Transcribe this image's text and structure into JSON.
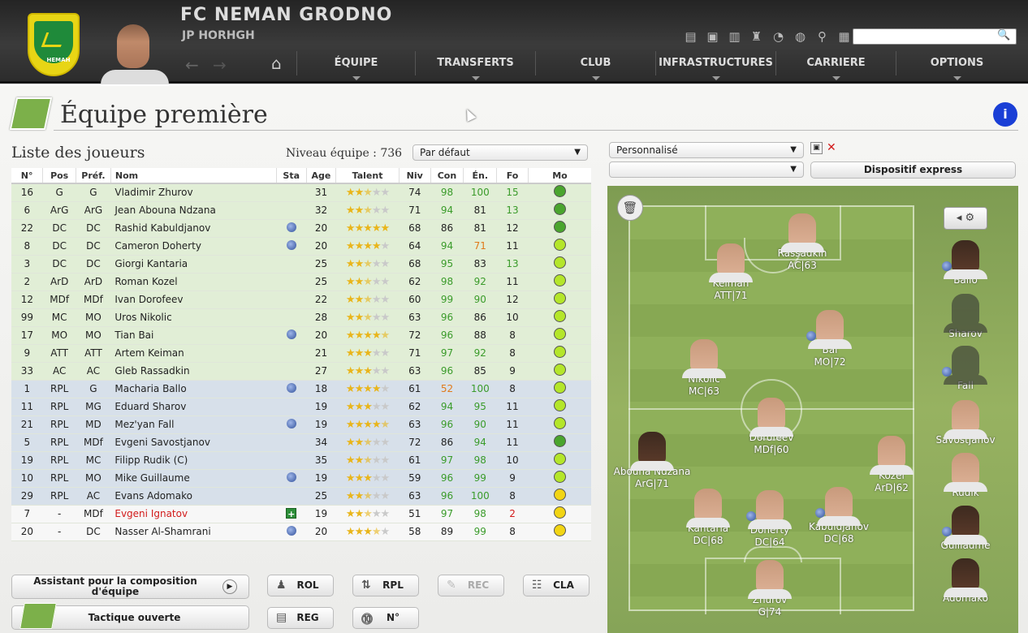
{
  "header": {
    "club_name": "FC NEMAN GRODNO",
    "manager_name": "JP HORHGH",
    "crest_text": "НЕМАН",
    "menu": [
      {
        "label": "ÉQUIPE"
      },
      {
        "label": "TRANSFERTS"
      },
      {
        "label": "CLUB"
      },
      {
        "label": "INFRASTRUCTURES"
      },
      {
        "label": "CARRIERE"
      },
      {
        "label": "OPTIONS"
      }
    ],
    "search": {
      "value": "",
      "placeholder": ""
    }
  },
  "page": {
    "title": "Équipe première",
    "info_label": "i"
  },
  "list": {
    "title": "Liste des joueurs",
    "team_level": "Niveau équipe : 736",
    "sort_select": "Par défaut",
    "columns": [
      "N°",
      "Pos",
      "Préf.",
      "Nom",
      "Sta",
      "Age",
      "Talent",
      "Niv",
      "Con",
      "Én.",
      "Fo",
      "Mo"
    ],
    "rows": [
      {
        "group": "first",
        "num": "16",
        "pos": "G",
        "pref": "G",
        "name": "Vladimir Zhurov",
        "sta": "",
        "age": "31",
        "stars": 2.5,
        "niv": "74",
        "con": "98",
        "en": "100",
        "fo": "15",
        "mo": "green",
        "con_c": "#3a9b2a",
        "en_c": "#3a9b2a",
        "fo_c": "#3a9b2a",
        "name_c": ""
      },
      {
        "group": "first",
        "num": "6",
        "pos": "ArG",
        "pref": "ArG",
        "name": "Jean Abouna Ndzana",
        "sta": "",
        "age": "32",
        "stars": 2.5,
        "niv": "71",
        "con": "94",
        "en": "81",
        "fo": "13",
        "mo": "green",
        "con_c": "#3a9b2a",
        "en_c": "",
        "fo_c": "#3a9b2a",
        "name_c": ""
      },
      {
        "group": "first",
        "num": "22",
        "pos": "DC",
        "pref": "DC",
        "name": "Rashid Kabuldjanov",
        "sta": "globe",
        "age": "20",
        "stars": 5,
        "niv": "68",
        "con": "86",
        "en": "81",
        "fo": "12",
        "mo": "green",
        "con_c": "",
        "en_c": "",
        "fo_c": "",
        "name_c": ""
      },
      {
        "group": "first",
        "num": "8",
        "pos": "DC",
        "pref": "DC",
        "name": "Cameron Doherty",
        "sta": "globe",
        "age": "20",
        "stars": 4,
        "niv": "64",
        "con": "94",
        "en": "71",
        "fo": "11",
        "mo": "lime",
        "con_c": "#3a9b2a",
        "en_c": "#e07a1a",
        "fo_c": "",
        "name_c": ""
      },
      {
        "group": "first",
        "num": "3",
        "pos": "DC",
        "pref": "DC",
        "name": "Giorgi Kantaria",
        "sta": "",
        "age": "25",
        "stars": 2.5,
        "niv": "68",
        "con": "95",
        "en": "83",
        "fo": "13",
        "mo": "lime",
        "con_c": "#3a9b2a",
        "en_c": "",
        "fo_c": "#3a9b2a",
        "name_c": ""
      },
      {
        "group": "first",
        "num": "2",
        "pos": "ArD",
        "pref": "ArD",
        "name": "Roman Kozel",
        "sta": "",
        "age": "25",
        "stars": 2.5,
        "niv": "62",
        "con": "98",
        "en": "92",
        "fo": "11",
        "mo": "lime",
        "con_c": "#3a9b2a",
        "en_c": "#3a9b2a",
        "fo_c": "",
        "name_c": ""
      },
      {
        "group": "first",
        "num": "12",
        "pos": "MDf",
        "pref": "MDf",
        "name": "Ivan Dorofeev",
        "sta": "",
        "age": "22",
        "stars": 2.5,
        "niv": "60",
        "con": "99",
        "en": "90",
        "fo": "12",
        "mo": "lime",
        "con_c": "#3a9b2a",
        "en_c": "#3a9b2a",
        "fo_c": "",
        "name_c": ""
      },
      {
        "group": "first",
        "num": "99",
        "pos": "MC",
        "pref": "MO",
        "name": "Uros Nikolic",
        "sta": "",
        "age": "28",
        "stars": 2.5,
        "niv": "63",
        "con": "96",
        "en": "86",
        "fo": "10",
        "mo": "lime",
        "con_c": "#3a9b2a",
        "en_c": "",
        "fo_c": "",
        "name_c": ""
      },
      {
        "group": "first",
        "num": "17",
        "pos": "MO",
        "pref": "MO",
        "name": "Tian Bai",
        "sta": "globe",
        "age": "20",
        "stars": 4.5,
        "niv": "72",
        "con": "96",
        "en": "88",
        "fo": "8",
        "mo": "lime",
        "con_c": "#3a9b2a",
        "en_c": "",
        "fo_c": "",
        "name_c": ""
      },
      {
        "group": "first",
        "num": "9",
        "pos": "ATT",
        "pref": "ATT",
        "name": "Artem Keiman",
        "sta": "",
        "age": "21",
        "stars": 3,
        "niv": "71",
        "con": "97",
        "en": "92",
        "fo": "8",
        "mo": "lime",
        "con_c": "#3a9b2a",
        "en_c": "#3a9b2a",
        "fo_c": "",
        "name_c": ""
      },
      {
        "group": "first",
        "num": "33",
        "pos": "AC",
        "pref": "AC",
        "name": "Gleb Rassadkin",
        "sta": "",
        "age": "27",
        "stars": 3,
        "niv": "63",
        "con": "96",
        "en": "85",
        "fo": "9",
        "mo": "lime",
        "con_c": "#3a9b2a",
        "en_c": "",
        "fo_c": "",
        "name_c": ""
      },
      {
        "group": "rpl",
        "num": "1",
        "pos": "RPL",
        "pref": "G",
        "name": "Macharia Ballo",
        "sta": "globe",
        "age": "18",
        "stars": 4,
        "niv": "61",
        "con": "52",
        "en": "100",
        "fo": "8",
        "mo": "lime",
        "con_c": "#e07a1a",
        "en_c": "#3a9b2a",
        "fo_c": "",
        "name_c": ""
      },
      {
        "group": "rpl",
        "num": "11",
        "pos": "RPL",
        "pref": "MG",
        "name": "Eduard Sharov",
        "sta": "",
        "age": "19",
        "stars": 3,
        "niv": "62",
        "con": "94",
        "en": "95",
        "fo": "11",
        "mo": "lime",
        "con_c": "#3a9b2a",
        "en_c": "#3a9b2a",
        "fo_c": "",
        "name_c": ""
      },
      {
        "group": "rpl",
        "num": "21",
        "pos": "RPL",
        "pref": "MD",
        "name": "Mez'yan Fall",
        "sta": "globe",
        "age": "19",
        "stars": 4.5,
        "niv": "63",
        "con": "96",
        "en": "90",
        "fo": "11",
        "mo": "lime",
        "con_c": "#3a9b2a",
        "en_c": "#3a9b2a",
        "fo_c": "",
        "name_c": ""
      },
      {
        "group": "rpl",
        "num": "5",
        "pos": "RPL",
        "pref": "MDf",
        "name": "Evgeni Savostjanov",
        "sta": "",
        "age": "34",
        "stars": 2.5,
        "niv": "72",
        "con": "86",
        "en": "94",
        "fo": "11",
        "mo": "green",
        "con_c": "",
        "en_c": "#3a9b2a",
        "fo_c": "",
        "name_c": ""
      },
      {
        "group": "rpl",
        "num": "19",
        "pos": "RPL",
        "pref": "MC",
        "name": "Filipp Rudik (C)",
        "sta": "",
        "age": "35",
        "stars": 2.5,
        "niv": "61",
        "con": "97",
        "en": "98",
        "fo": "10",
        "mo": "lime",
        "con_c": "#3a9b2a",
        "en_c": "#3a9b2a",
        "fo_c": "",
        "name_c": ""
      },
      {
        "group": "rpl",
        "num": "10",
        "pos": "RPL",
        "pref": "MO",
        "name": "Mike Guillaume",
        "sta": "globe",
        "age": "19",
        "stars": 3,
        "niv": "59",
        "con": "96",
        "en": "99",
        "fo": "9",
        "mo": "lime",
        "con_c": "#3a9b2a",
        "en_c": "#3a9b2a",
        "fo_c": "",
        "name_c": ""
      },
      {
        "group": "rpl",
        "num": "29",
        "pos": "RPL",
        "pref": "AC",
        "name": "Evans Adomako",
        "sta": "",
        "age": "25",
        "stars": 2.5,
        "niv": "63",
        "con": "96",
        "en": "100",
        "fo": "8",
        "mo": "yellow",
        "con_c": "#3a9b2a",
        "en_c": "#3a9b2a",
        "fo_c": "",
        "name_c": ""
      },
      {
        "group": "other",
        "num": "7",
        "pos": "-",
        "pref": "MDf",
        "name": "Evgeni Ignatov",
        "sta": "inj",
        "age": "19",
        "stars": 2.5,
        "niv": "51",
        "con": "97",
        "en": "98",
        "fo": "2",
        "mo": "yellow",
        "con_c": "#3a9b2a",
        "en_c": "#3a9b2a",
        "fo_c": "#d21a1a",
        "name_c": "#d21a1a"
      },
      {
        "group": "other",
        "num": "20",
        "pos": "-",
        "pref": "DC",
        "name": "Nasser Al-Shamrani",
        "sta": "globe",
        "age": "20",
        "stars": 3.5,
        "niv": "58",
        "con": "89",
        "en": "99",
        "fo": "8",
        "mo": "yellow",
        "con_c": "",
        "en_c": "#3a9b2a",
        "fo_c": "",
        "name_c": ""
      }
    ]
  },
  "buttons": {
    "assistant": "Assistant pour la composition d'équipe",
    "rol": "ROL",
    "rpl": "RPL",
    "rec": "REC",
    "cla": "CLA",
    "tactic": "Tactique ouverte",
    "reg": "REG",
    "num": "N°"
  },
  "tactics": {
    "formation_select": "Personnalisé",
    "second_select": "",
    "express_button": "Dispositif express"
  },
  "pitch_players": [
    {
      "name": "Rassadkin",
      "role": "AC|63",
      "dark": false,
      "globe": false
    },
    {
      "name": "Keiman",
      "role": "ATT|71",
      "dark": false,
      "globe": false
    },
    {
      "name": "Bai",
      "role": "MO|72",
      "dark": false,
      "globe": true
    },
    {
      "name": "Nikolic",
      "role": "MC|63",
      "dark": false,
      "globe": false
    },
    {
      "name": "Dorofeev",
      "role": "MDf|60",
      "dark": false,
      "globe": false
    },
    {
      "name": "Abouna Ndzana",
      "role": "ArG|71",
      "dark": true,
      "globe": false
    },
    {
      "name": "Kozel",
      "role": "ArD|62",
      "dark": false,
      "globe": false
    },
    {
      "name": "Kantaria",
      "role": "DC|68",
      "dark": false,
      "globe": false
    },
    {
      "name": "Doherty",
      "role": "DC|64",
      "dark": false,
      "globe": true
    },
    {
      "name": "Kabuldjanov",
      "role": "DC|68",
      "dark": false,
      "globe": true
    },
    {
      "name": "Zhurov",
      "role": "G|74",
      "dark": false,
      "globe": false
    }
  ],
  "bench": [
    {
      "name": "Ballo",
      "dark": true,
      "ghost": false,
      "globe": true
    },
    {
      "name": "Sharov",
      "dark": false,
      "ghost": true,
      "globe": false
    },
    {
      "name": "Fall",
      "dark": false,
      "ghost": true,
      "globe": true
    },
    {
      "name": "Savostjanov",
      "dark": false,
      "ghost": false,
      "globe": false
    },
    {
      "name": "Rudik",
      "dark": false,
      "ghost": false,
      "globe": false
    },
    {
      "name": "Guillaume",
      "dark": true,
      "ghost": false,
      "globe": true
    },
    {
      "name": "Adomako",
      "dark": true,
      "ghost": false,
      "globe": false
    }
  ],
  "colors": {
    "accent_blue": "#1a3fd6",
    "mo_green": "#4aa52e",
    "mo_lime": "#b4e62a",
    "mo_yellow": "#f2d514",
    "rpl_row": "#d7e0ea",
    "first_row": "#e1eed6"
  }
}
